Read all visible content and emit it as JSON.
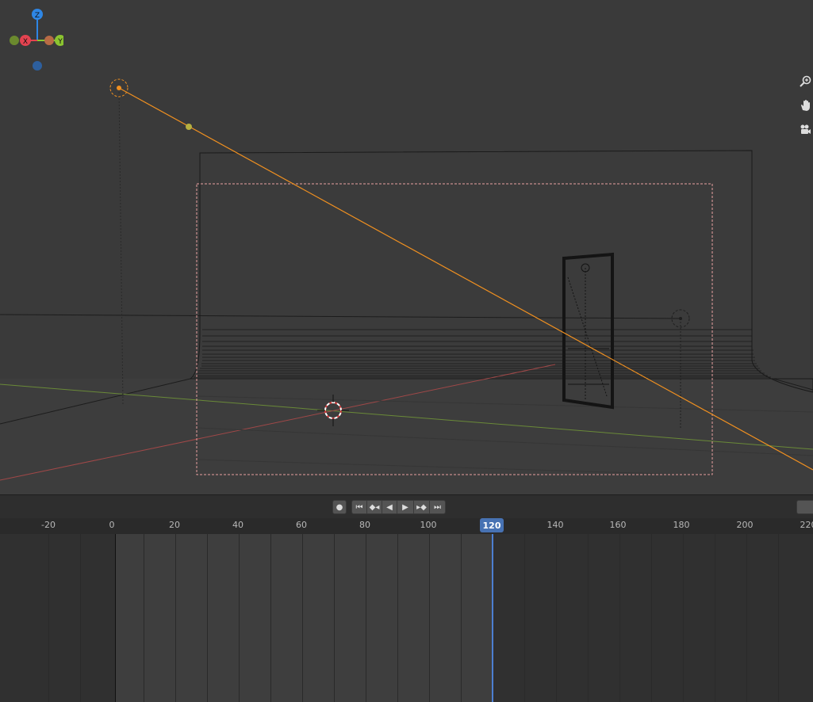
{
  "viewport": {
    "gizmo": {
      "x_label": "X",
      "y_label": "Y",
      "z_label": "Z",
      "colors": {
        "x": "#e34350",
        "y": "#8bc430",
        "z": "#2e86e5",
        "neg_x": "#6b8a2e",
        "neg_y": "#b86b45",
        "neg_z": "#2d5f9e"
      }
    },
    "nav_icons": [
      "zoom-icon",
      "hand-pan-icon",
      "camera-icon"
    ],
    "colors": {
      "background": "#3a3a3a",
      "light_line": "#f09020",
      "x_axis": "#b04848",
      "y_axis": "#6a8a38",
      "border": "#e8a0a0"
    }
  },
  "timeline": {
    "buttons": {
      "record": "●",
      "jump_start": "⏮",
      "prev_keyframe": "◆◂",
      "play_reverse": "◀",
      "play": "▶",
      "next_keyframe": "▸◆",
      "jump_end": "⏭"
    },
    "ruler_labels": [
      "-20",
      "0",
      "20",
      "40",
      "60",
      "80",
      "100",
      "120",
      "140",
      "160",
      "180",
      "200",
      "220"
    ],
    "current_frame": "120",
    "colors": {
      "playhead": "#4d7fd1",
      "frame_indicator": "#4772b3"
    }
  }
}
